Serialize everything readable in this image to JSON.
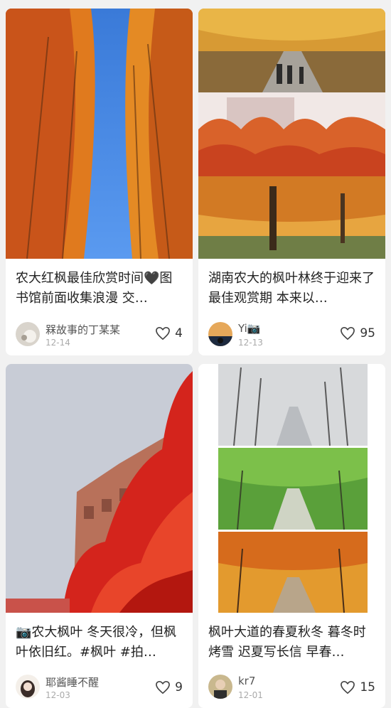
{
  "cards": [
    {
      "title": "农大红枫最佳欣赏时间🖤图书馆前面收集浪漫 交…",
      "author": "槑故事的丁某某",
      "date": "12-14",
      "likes": "4",
      "image_desc": "orange-maple-trees-sky"
    },
    {
      "title": "湖南农大的枫叶林终于迎来了最佳观赏期 本来以…",
      "author": "Yi📷",
      "date": "12-13",
      "likes": "95",
      "image_desc": "maple-avenue-collage"
    },
    {
      "title": "📷农大枫叶 冬天很冷，但枫叶依旧红。#枫叶 #拍…",
      "author": "耶酱睡不醒",
      "date": "12-03",
      "likes": "9",
      "image_desc": "red-maple-building"
    },
    {
      "title": "枫叶大道的春夏秋冬 暮冬时烤雪 迟夏写长信 早春…",
      "author": "kr7",
      "date": "12-01",
      "likes": "15",
      "image_desc": "four-seasons-avenue"
    }
  ],
  "colors": {
    "background": "#f1f1f1",
    "card": "#ffffff",
    "text": "#222222",
    "muted": "#aaaaaa"
  }
}
